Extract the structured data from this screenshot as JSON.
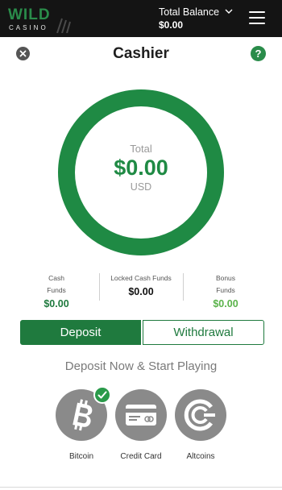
{
  "header": {
    "logo_word": "WILD",
    "logo_sub": "CASINO",
    "balance_label": "Total Balance",
    "balance_value": "$0.00",
    "title": "Cashier",
    "help_label": "?"
  },
  "ring": {
    "label": "Total",
    "amount": "$0.00",
    "currency": "USD"
  },
  "funds": [
    {
      "label_line1": "Cash",
      "label_line2": "Funds",
      "value": "$0.00",
      "color": "#1f7a3e"
    },
    {
      "label_line1": "Locked Cash Funds",
      "label_line2": "",
      "value": "$0.00",
      "color": "#111111"
    },
    {
      "label_line1": "Bonus",
      "label_line2": "Funds",
      "value": "$0.00",
      "color": "#5ab34a"
    }
  ],
  "tabs": {
    "deposit": "Deposit",
    "withdrawal": "Withdrawal"
  },
  "tagline": "Deposit Now & Start Playing",
  "methods": [
    {
      "label": "Bitcoin",
      "icon": "bitcoin-icon",
      "selected": true
    },
    {
      "label": "Credit Card",
      "icon": "credit-card-icon",
      "selected": false
    },
    {
      "label": "Altcoins",
      "icon": "altcoins-icon",
      "selected": false
    }
  ],
  "colors": {
    "brand_green": "#1f7a3e",
    "ring_green": "#1f8a44",
    "bonus_green": "#5ab34a",
    "topbar": "#141414"
  }
}
